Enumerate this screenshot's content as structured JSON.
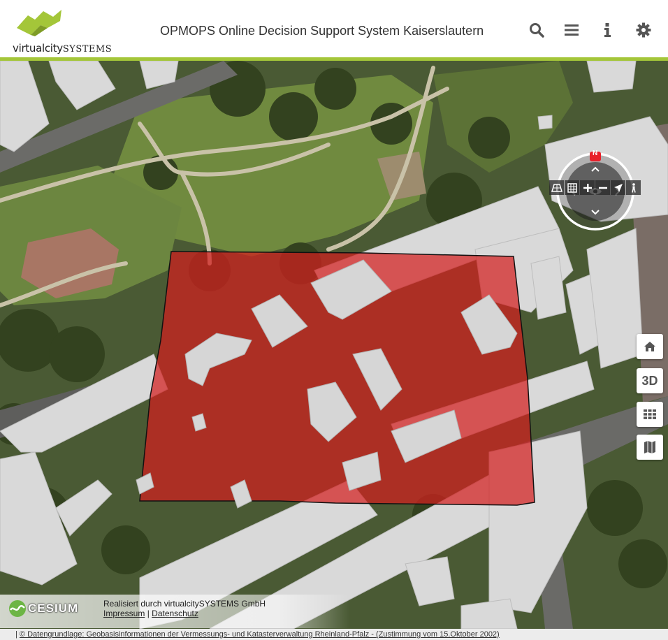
{
  "header": {
    "logo_text_a": "virtualcity",
    "logo_text_b": "SYSTEMS",
    "title": "OPMOPS Online Decision Support System Kaiserslautern",
    "buttons": [
      {
        "name": "search-button",
        "icon": "search-icon"
      },
      {
        "name": "menu-button",
        "icon": "hamburger-menu-icon"
      },
      {
        "name": "info-button",
        "icon": "info-icon"
      },
      {
        "name": "settings-button",
        "icon": "gear-icon"
      }
    ]
  },
  "colors": {
    "brand_green": "#a4c639",
    "selection_red": "#d21f1f",
    "compass_red": "#e8202a"
  },
  "compass": {
    "north_label": "N",
    "icons": [
      "chevron-up-icon",
      "chevron-down-icon",
      "chevron-left-icon",
      "chevron-right-icon",
      "eye-icon"
    ]
  },
  "compass_toolbar": [
    "tilt-icon",
    "grid-icon",
    "zoom-in-icon",
    "zoom-out-icon",
    "locate-icon",
    "pedestrian-icon"
  ],
  "side_buttons": {
    "home": "home-icon",
    "mode_3d": "3D",
    "layers": "grid-icon",
    "map": "map-icon"
  },
  "credits": {
    "cesium": "CESIUM",
    "realized_by": "Realisiert durch virtualcitySYSTEMS GmbH",
    "impressum": "Impressum",
    "separator": "|",
    "datenschutz": "Datenschutz",
    "footer_prefix": "|",
    "footer_link": "© Datengrundlage: Geobasisinformationen der Vermessungs- und Katasterverwaltung Rheinland-Pfalz - (Zustimmung vom 15.Oktober 2002)"
  }
}
